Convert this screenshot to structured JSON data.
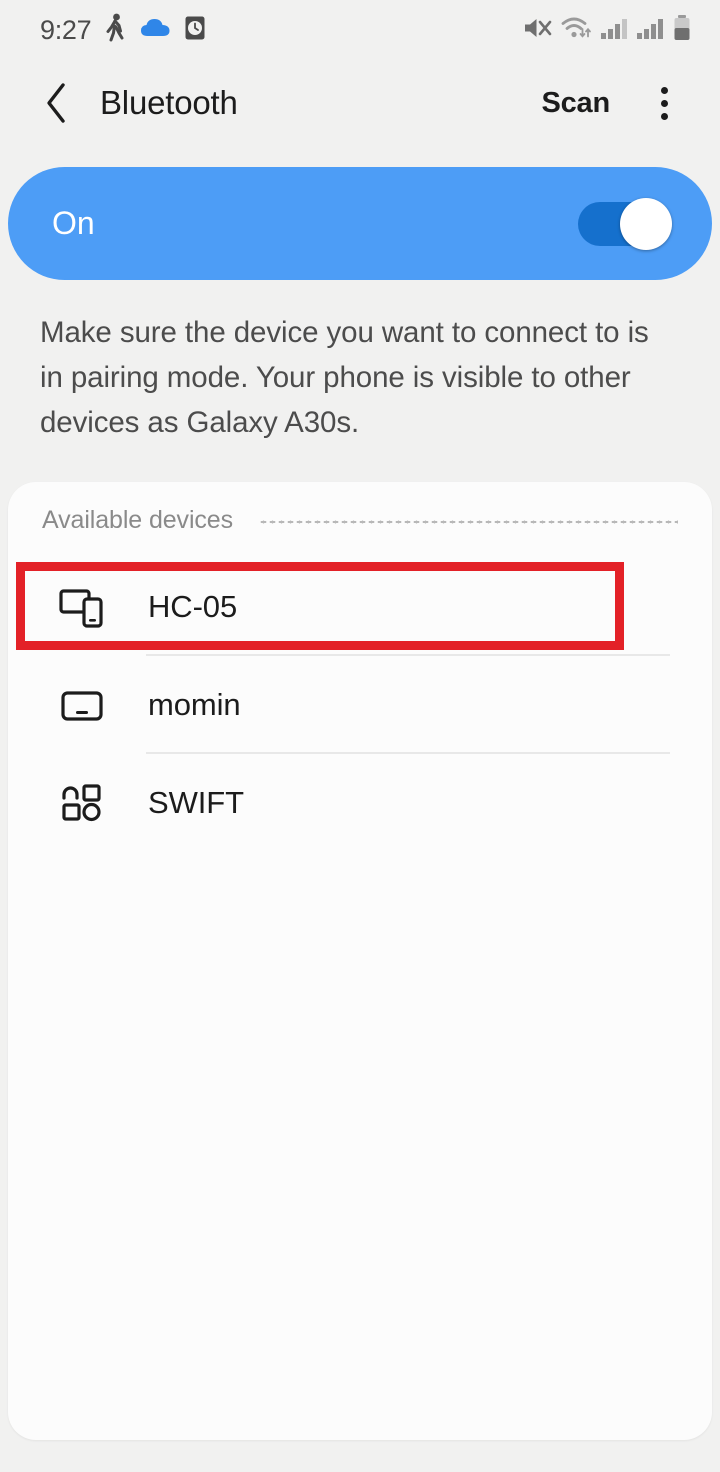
{
  "status_bar": {
    "time": "9:27",
    "left_icons": [
      {
        "name": "pedometer-walking-icon"
      },
      {
        "name": "cloud-icon",
        "color": "#3f8ae0"
      },
      {
        "name": "alarm-clock-icon"
      }
    ],
    "right_icons": [
      {
        "name": "mute-volume-off-icon"
      },
      {
        "name": "wifi-icon"
      },
      {
        "name": "signal-bars-sim1-icon"
      },
      {
        "name": "signal-bars-sim2-icon"
      },
      {
        "name": "battery-icon"
      }
    ]
  },
  "header": {
    "back_label": "‹",
    "title": "Bluetooth",
    "scan_label": "Scan",
    "overflow_label": "More options"
  },
  "toggle_card": {
    "label": "On",
    "state": "on",
    "card_color": "#4d9df6",
    "track_color": "#1570cd",
    "knob_color": "#ffffff"
  },
  "description": {
    "text": "Make sure the device you want to connect to is in pairing mode. Your phone is visible to other devices as Galaxy A30s."
  },
  "available_devices": {
    "section_title": "Available devices",
    "items": [
      {
        "name": "HC-05",
        "icon": "multiple-devices-icon",
        "highlighted": true
      },
      {
        "name": "momin",
        "icon": "laptop-computer-icon",
        "highlighted": false
      },
      {
        "name": "SWIFT",
        "icon": "unknown-device-icon",
        "highlighted": false
      }
    ]
  },
  "annotation": {
    "target": "HC-05",
    "color": "#e32127"
  }
}
